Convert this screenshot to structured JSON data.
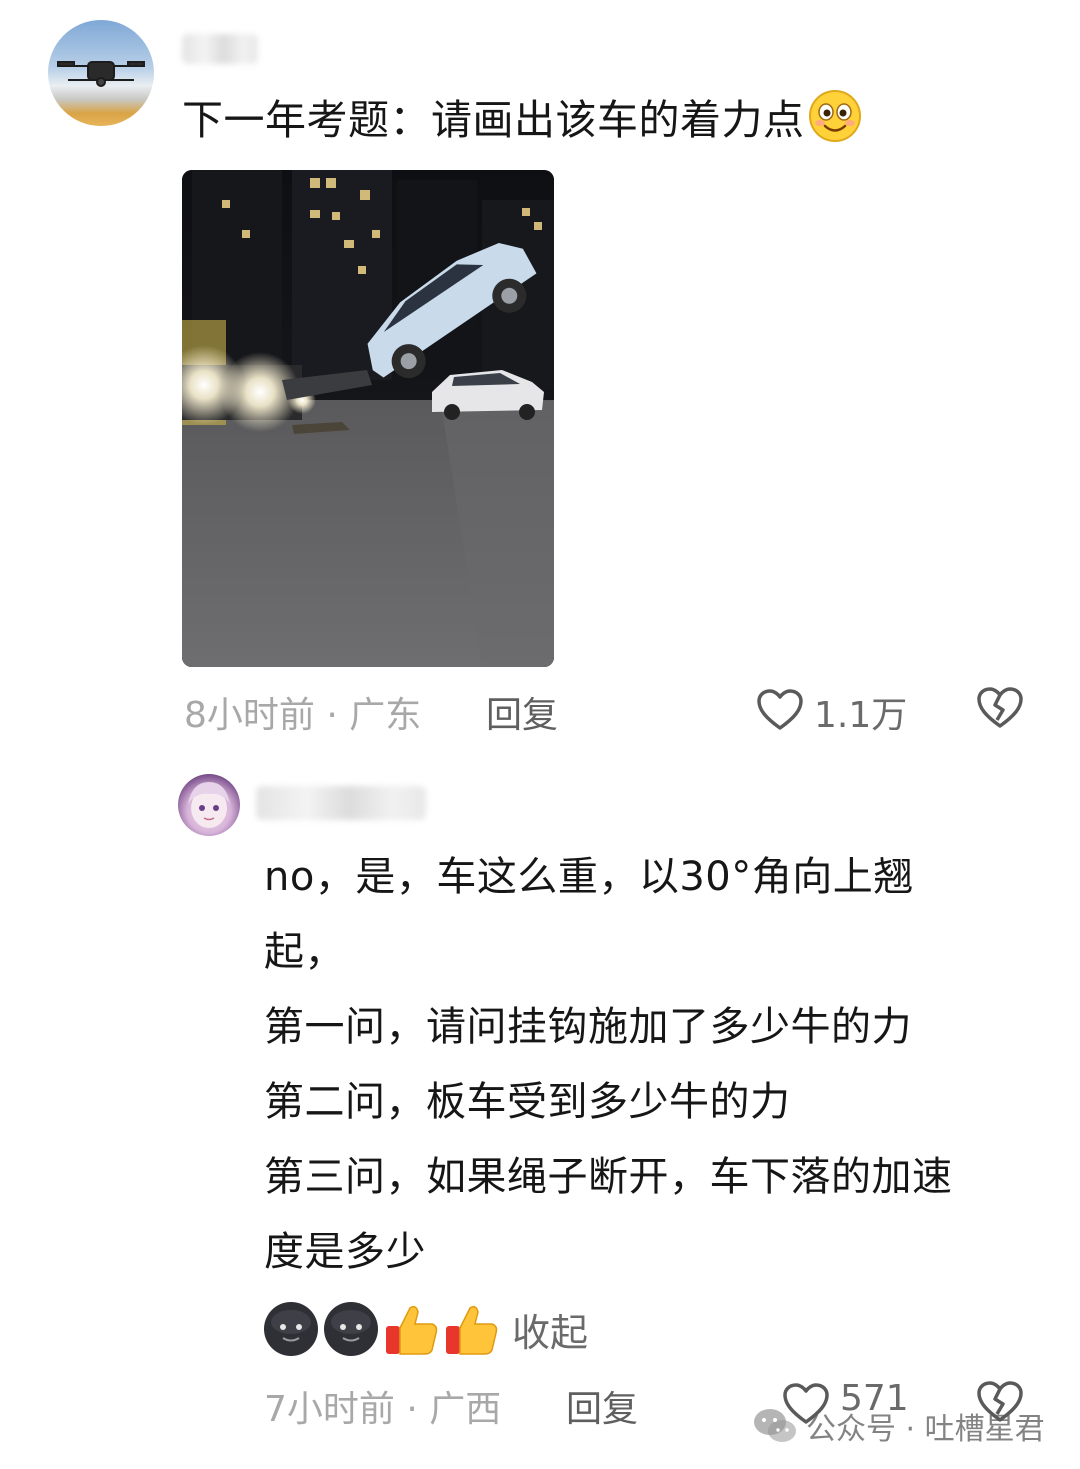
{
  "comments": [
    {
      "avatar": "drone-avatar",
      "text": "下一年考题：请画出该车的着力点",
      "emoji": "smiley-emoji",
      "image": "car-lifted-photo",
      "time_location": "8小时前 · 广东",
      "reply_label": "回复",
      "like_count": "1.1万"
    },
    {
      "avatar": "anime-girl-avatar",
      "lines": [
        "no，是，车这么重，以30°角向上翘",
        "起，",
        "第一问，请问挂钩施加了多少牛的力",
        "第二问，板车受到多少牛的力",
        "第三问，如果绳子断开，车下落的加速",
        "度是多少"
      ],
      "reaction_emojis": [
        "dark-face-emoji",
        "dark-face-emoji",
        "thumbs-up-emoji",
        "thumbs-up-emoji"
      ],
      "collapse_label": "收起",
      "time_location": "7小时前 · 广西",
      "reply_label": "回复",
      "like_count": "571"
    }
  ],
  "watermark": {
    "text": "公众号 · 吐槽星君"
  },
  "colors": {
    "meta": "#a8a8a8",
    "text": "#161616",
    "reply": "#5f5f5f"
  }
}
